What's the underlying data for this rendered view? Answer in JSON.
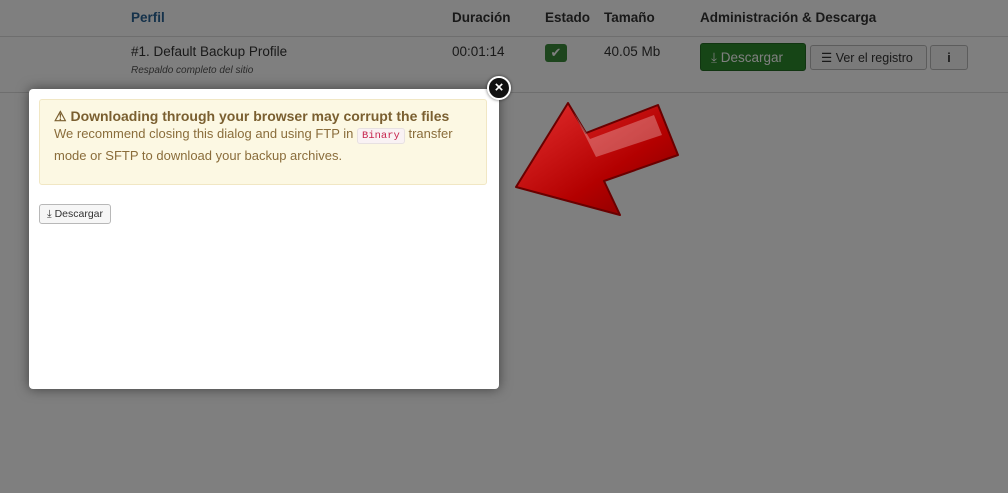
{
  "table": {
    "headers": {
      "profile": "Perfil",
      "duration": "Duración",
      "status": "Estado",
      "size": "Tamaño",
      "admin": "Administración & Descarga"
    },
    "row": {
      "profile_name": "#1. Default Backup Profile",
      "profile_description": "Respaldo completo del sitio",
      "duration": "00:01:14",
      "size": "40.05 Mb",
      "download_label": "Descargar",
      "view_log_label": "Ver el registro",
      "info_label": "i"
    }
  },
  "dialog": {
    "warning_title": "Downloading through your browser may corrupt the files",
    "warning_text_before": "We recommend closing this dialog and using FTP in",
    "warning_code": "Binary",
    "warning_text_after": "transfer mode or SFTP to download your backup archives.",
    "download_label": "Descargar"
  },
  "icons": {
    "warning": "warning-triangle-icon",
    "download": "download-icon",
    "list": "list-icon",
    "check": "check-icon",
    "close": "close-icon",
    "arrow": "red-arrow-icon"
  },
  "colors": {
    "alert_bg": "#fcf8e3",
    "alert_text": "#8a6d3b",
    "success": "#2d8a2d",
    "arrow": "#c00000"
  }
}
